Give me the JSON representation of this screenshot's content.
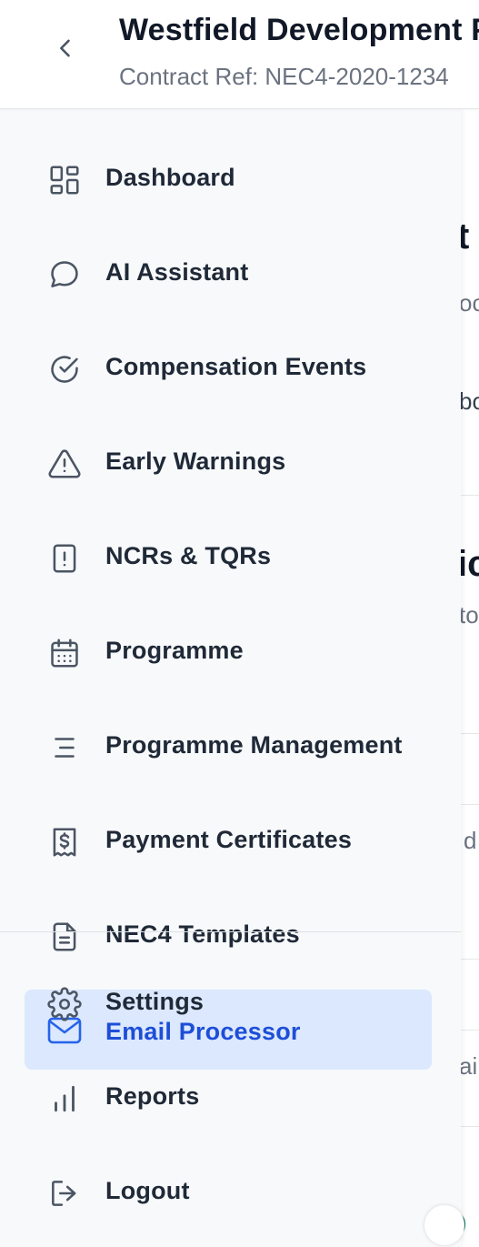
{
  "header": {
    "project_title": "Westfield Development P",
    "contract_ref": "Contract Ref: NEC4-2020-1234"
  },
  "background_peek": {
    "t1": "t",
    "t2": "oc",
    "t3": "bo",
    "t4": "ic",
    "t5": "to",
    "t6": "d",
    "t7": "ail"
  },
  "sidebar": {
    "items": [
      {
        "label": "Dashboard",
        "icon": "dashboard-grid-icon"
      },
      {
        "label": "AI Assistant",
        "icon": "chat-bubble-icon"
      },
      {
        "label": "Compensation Events",
        "icon": "check-circle-icon"
      },
      {
        "label": "Early Warnings",
        "icon": "warning-triangle-icon"
      },
      {
        "label": "NCRs & TQRs",
        "icon": "alert-document-icon"
      },
      {
        "label": "Programme",
        "icon": "calendar-icon"
      },
      {
        "label": "Programme Management",
        "icon": "list-lines-icon"
      },
      {
        "label": "Payment Certificates",
        "icon": "receipt-dollar-icon"
      },
      {
        "label": "NEC4 Templates",
        "icon": "document-icon"
      },
      {
        "label": "Settings",
        "icon": "gear-icon"
      },
      {
        "label": "Email Processor",
        "icon": "mail-icon",
        "active": true
      },
      {
        "label": "Reports",
        "icon": "bar-chart-icon"
      },
      {
        "label": "Logout",
        "icon": "logout-icon"
      }
    ]
  },
  "colors": {
    "active_bg": "#dbe8fd",
    "active_text": "#1d4ed8",
    "text": "#1f2937",
    "muted": "#6b7280"
  }
}
